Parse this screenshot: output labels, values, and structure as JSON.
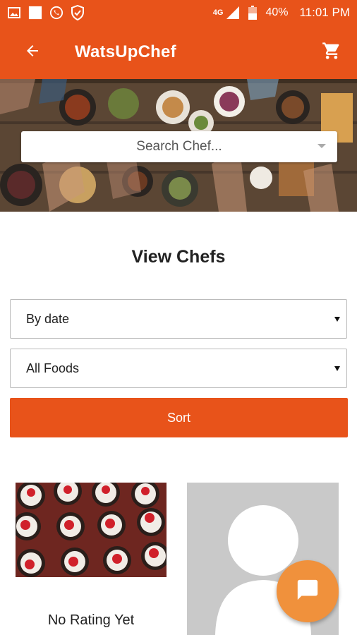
{
  "status_bar": {
    "network": "4G",
    "battery": "40%",
    "time": "11:01 PM",
    "icons": [
      "image-icon",
      "square-icon",
      "whatsapp-icon",
      "shield-icon",
      "signal-icon",
      "battery-icon"
    ]
  },
  "app_bar": {
    "title": "WatsUpChef",
    "back_icon": "arrow-left-icon",
    "cart_icon": "cart-icon"
  },
  "search": {
    "placeholder": "Search Chef..."
  },
  "main": {
    "title": "View Chefs",
    "sort_by": {
      "selected": "By date"
    },
    "food_filter": {
      "selected": "All Foods"
    },
    "sort_button": "Sort"
  },
  "chefs": [
    {
      "rating": "No Rating Yet"
    },
    {
      "rating": ""
    }
  ],
  "chat_fab": {
    "icon": "chat-icon"
  },
  "colors": {
    "primary": "#E8531A",
    "fab": "#F0913C"
  }
}
